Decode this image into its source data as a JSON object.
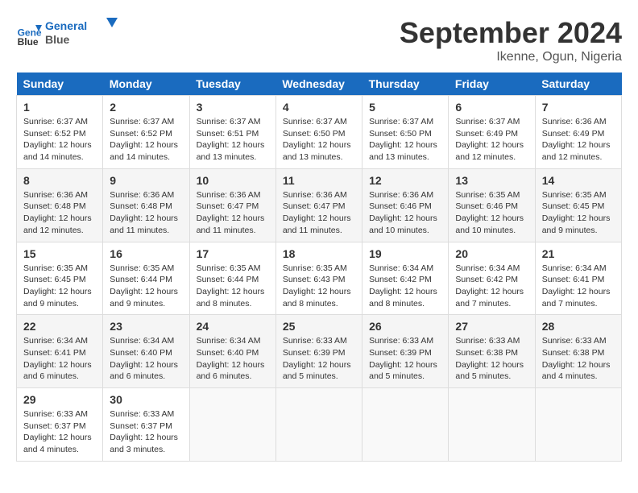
{
  "header": {
    "logo_line1": "General",
    "logo_line2": "Blue",
    "month": "September 2024",
    "location": "Ikenne, Ogun, Nigeria"
  },
  "weekdays": [
    "Sunday",
    "Monday",
    "Tuesday",
    "Wednesday",
    "Thursday",
    "Friday",
    "Saturday"
  ],
  "weeks": [
    [
      {
        "day": 1,
        "sunrise": "6:37 AM",
        "sunset": "6:52 PM",
        "daylight": "12 hours and 14 minutes."
      },
      {
        "day": 2,
        "sunrise": "6:37 AM",
        "sunset": "6:52 PM",
        "daylight": "12 hours and 14 minutes."
      },
      {
        "day": 3,
        "sunrise": "6:37 AM",
        "sunset": "6:51 PM",
        "daylight": "12 hours and 13 minutes."
      },
      {
        "day": 4,
        "sunrise": "6:37 AM",
        "sunset": "6:50 PM",
        "daylight": "12 hours and 13 minutes."
      },
      {
        "day": 5,
        "sunrise": "6:37 AM",
        "sunset": "6:50 PM",
        "daylight": "12 hours and 13 minutes."
      },
      {
        "day": 6,
        "sunrise": "6:37 AM",
        "sunset": "6:49 PM",
        "daylight": "12 hours and 12 minutes."
      },
      {
        "day": 7,
        "sunrise": "6:36 AM",
        "sunset": "6:49 PM",
        "daylight": "12 hours and 12 minutes."
      }
    ],
    [
      {
        "day": 8,
        "sunrise": "6:36 AM",
        "sunset": "6:48 PM",
        "daylight": "12 hours and 12 minutes."
      },
      {
        "day": 9,
        "sunrise": "6:36 AM",
        "sunset": "6:48 PM",
        "daylight": "12 hours and 11 minutes."
      },
      {
        "day": 10,
        "sunrise": "6:36 AM",
        "sunset": "6:47 PM",
        "daylight": "12 hours and 11 minutes."
      },
      {
        "day": 11,
        "sunrise": "6:36 AM",
        "sunset": "6:47 PM",
        "daylight": "12 hours and 11 minutes."
      },
      {
        "day": 12,
        "sunrise": "6:36 AM",
        "sunset": "6:46 PM",
        "daylight": "12 hours and 10 minutes."
      },
      {
        "day": 13,
        "sunrise": "6:35 AM",
        "sunset": "6:46 PM",
        "daylight": "12 hours and 10 minutes."
      },
      {
        "day": 14,
        "sunrise": "6:35 AM",
        "sunset": "6:45 PM",
        "daylight": "12 hours and 9 minutes."
      }
    ],
    [
      {
        "day": 15,
        "sunrise": "6:35 AM",
        "sunset": "6:45 PM",
        "daylight": "12 hours and 9 minutes."
      },
      {
        "day": 16,
        "sunrise": "6:35 AM",
        "sunset": "6:44 PM",
        "daylight": "12 hours and 9 minutes."
      },
      {
        "day": 17,
        "sunrise": "6:35 AM",
        "sunset": "6:44 PM",
        "daylight": "12 hours and 8 minutes."
      },
      {
        "day": 18,
        "sunrise": "6:35 AM",
        "sunset": "6:43 PM",
        "daylight": "12 hours and 8 minutes."
      },
      {
        "day": 19,
        "sunrise": "6:34 AM",
        "sunset": "6:42 PM",
        "daylight": "12 hours and 8 minutes."
      },
      {
        "day": 20,
        "sunrise": "6:34 AM",
        "sunset": "6:42 PM",
        "daylight": "12 hours and 7 minutes."
      },
      {
        "day": 21,
        "sunrise": "6:34 AM",
        "sunset": "6:41 PM",
        "daylight": "12 hours and 7 minutes."
      }
    ],
    [
      {
        "day": 22,
        "sunrise": "6:34 AM",
        "sunset": "6:41 PM",
        "daylight": "12 hours and 6 minutes."
      },
      {
        "day": 23,
        "sunrise": "6:34 AM",
        "sunset": "6:40 PM",
        "daylight": "12 hours and 6 minutes."
      },
      {
        "day": 24,
        "sunrise": "6:34 AM",
        "sunset": "6:40 PM",
        "daylight": "12 hours and 6 minutes."
      },
      {
        "day": 25,
        "sunrise": "6:33 AM",
        "sunset": "6:39 PM",
        "daylight": "12 hours and 5 minutes."
      },
      {
        "day": 26,
        "sunrise": "6:33 AM",
        "sunset": "6:39 PM",
        "daylight": "12 hours and 5 minutes."
      },
      {
        "day": 27,
        "sunrise": "6:33 AM",
        "sunset": "6:38 PM",
        "daylight": "12 hours and 5 minutes."
      },
      {
        "day": 28,
        "sunrise": "6:33 AM",
        "sunset": "6:38 PM",
        "daylight": "12 hours and 4 minutes."
      }
    ],
    [
      {
        "day": 29,
        "sunrise": "6:33 AM",
        "sunset": "6:37 PM",
        "daylight": "12 hours and 4 minutes."
      },
      {
        "day": 30,
        "sunrise": "6:33 AM",
        "sunset": "6:37 PM",
        "daylight": "12 hours and 3 minutes."
      },
      null,
      null,
      null,
      null,
      null
    ]
  ],
  "labels": {
    "sunrise": "Sunrise:",
    "sunset": "Sunset:",
    "daylight": "Daylight:"
  }
}
